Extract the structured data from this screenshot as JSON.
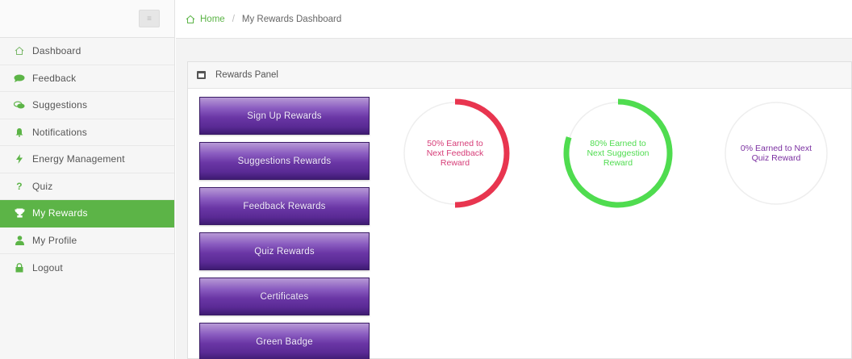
{
  "sidebar": {
    "items": [
      {
        "label": "Dashboard",
        "icon": "home-icon",
        "active": false
      },
      {
        "label": "Feedback",
        "icon": "comment-icon",
        "active": false
      },
      {
        "label": "Suggestions",
        "icon": "comments-icon",
        "active": false
      },
      {
        "label": "Notifications",
        "icon": "bell-icon",
        "active": false
      },
      {
        "label": "Energy Management",
        "icon": "bolt-icon",
        "active": false
      },
      {
        "label": "Quiz",
        "icon": "question-icon",
        "active": false
      },
      {
        "label": "My Rewards",
        "icon": "trophy-icon",
        "active": true
      },
      {
        "label": "My Profile",
        "icon": "user-icon",
        "active": false
      },
      {
        "label": "Logout",
        "icon": "lock-icon",
        "active": false
      }
    ]
  },
  "breadcrumb": {
    "home": "Home",
    "separator": "/",
    "current": "My Rewards Dashboard"
  },
  "panel": {
    "title": "Rewards Panel",
    "icon": "window-icon"
  },
  "buttons": [
    "Sign Up Rewards",
    "Suggestions Rewards",
    "Feedback Rewards",
    "Quiz Rewards",
    "Certificates",
    "Green Badge"
  ],
  "gauges": [
    {
      "text": "50% Earned to Next Feedback Reward",
      "percent": 50,
      "color": "#e8354f",
      "text_color": "#d63c77"
    },
    {
      "text": "80% Earned to Next Suggestion Reward",
      "percent": 80,
      "color": "#4fdc4f",
      "text_color": "#4fdc4f"
    },
    {
      "text": "0% Earned to Next Quiz Reward",
      "percent": 0,
      "color": "#7a2fa0",
      "text_color": "#7a2fa0"
    }
  ],
  "colors": {
    "accent": "#5cb447",
    "button_purple": "#6a36a5"
  }
}
